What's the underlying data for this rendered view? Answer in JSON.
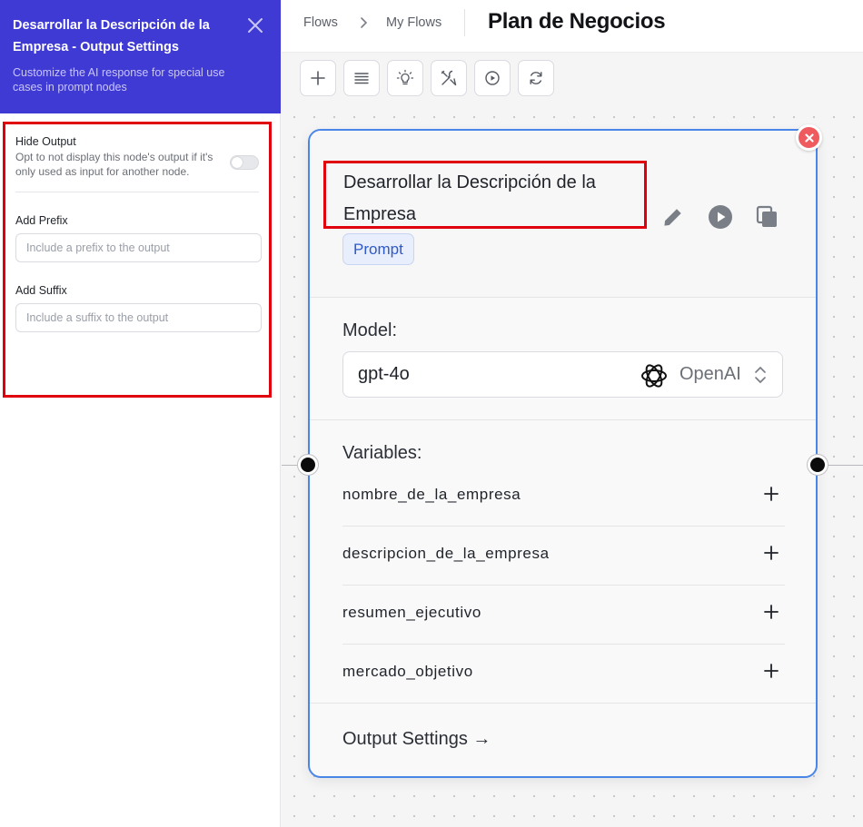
{
  "panel": {
    "title": "Desarrollar la Descripción de la Empresa - Output Settings",
    "subtitle": "Customize the AI response for special use cases in prompt nodes",
    "hide_output": {
      "title": "Hide Output",
      "description": "Opt to not display this node's output if it's only used as input for another node.",
      "enabled": false
    },
    "prefix": {
      "label": "Add Prefix",
      "placeholder": "Include a prefix to the output",
      "value": ""
    },
    "suffix": {
      "label": "Add Suffix",
      "placeholder": "Include a suffix to the output",
      "value": ""
    }
  },
  "breadcrumb": {
    "items": [
      "Flows",
      "My Flows"
    ]
  },
  "flow_title": "Plan de Negocios",
  "toolbar": {
    "icons": [
      "plus-icon",
      "list-icon",
      "lightbulb-icon",
      "tools-icon",
      "play-circle-icon",
      "refresh-icon"
    ]
  },
  "node": {
    "title_line1": "Desarrollar la Descripción de la",
    "title_line2": "Empresa",
    "badge": "Prompt",
    "model_label": "Model:",
    "model_value": "gpt-4o",
    "provider": "OpenAI",
    "variables_label": "Variables:",
    "variables": [
      "nombre_de_la_empresa",
      "descripcion_de_la_empresa",
      "resumen_ejecutivo",
      "mercado_objetivo"
    ],
    "output_settings_link": "Output Settings →"
  },
  "colors": {
    "panel_header": "#3f3ad3",
    "node_border": "#4a86e8",
    "highlight": "#e0000d",
    "badge_text": "#2e59c9",
    "delete": "#ef5a5f"
  }
}
